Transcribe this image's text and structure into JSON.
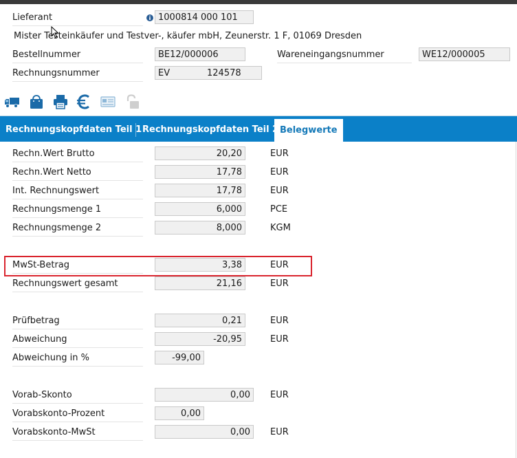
{
  "header": {
    "lieferant_label": "Lieferant",
    "lieferant_value": "1000814 000 101",
    "address": "Mister Testeinkäufer und Testver-, käufer mbH, Zeunerstr. 1 F, 01069 Dresden",
    "bestellnummer_label": "Bestellnummer",
    "bestellnummer_value": "BE12/000006",
    "wareneingang_label": "Wareneingangsnummer",
    "wareneingang_value": "WE12/000005",
    "rechnungsnummer_label": "Rechnungsnummer",
    "rechnungsnummer_prefix": "EV",
    "rechnungsnummer_value": "124578"
  },
  "toolbar": {
    "icons": [
      "truck-icon",
      "bag-icon",
      "printer-icon",
      "euro-icon",
      "card-icon",
      "lock-icon"
    ],
    "colors": {
      "primary": "#1479b8"
    }
  },
  "tabs": [
    {
      "label": "Rechnungskopfdaten Teil 1",
      "active": false
    },
    {
      "label": "Rechnungskopfdaten Teil 2",
      "active": false
    },
    {
      "label": "Belegwerte",
      "active": true
    }
  ],
  "rows": {
    "brutto": {
      "label": "Rechn.Wert Brutto",
      "value": "20,20",
      "unit": "EUR"
    },
    "netto": {
      "label": "Rechn.Wert Netto",
      "value": "17,78",
      "unit": "EUR"
    },
    "int_wert": {
      "label": "Int. Rechnungswert",
      "value": "17,78",
      "unit": "EUR"
    },
    "menge1": {
      "label": "Rechnungsmenge 1",
      "value": "6,000",
      "unit": "PCE"
    },
    "menge2": {
      "label": "Rechnungsmenge 2",
      "value": "8,000",
      "unit": "KGM"
    },
    "mwst": {
      "label": "MwSt-Betrag",
      "value": "3,38",
      "unit": "EUR"
    },
    "gesamt": {
      "label": "Rechnungswert gesamt",
      "value": "21,16",
      "unit": "EUR"
    },
    "pruef": {
      "label": "Prüfbetrag",
      "value": "0,21",
      "unit": "EUR"
    },
    "abw": {
      "label": "Abweichung",
      "value": "-20,95",
      "unit": "EUR"
    },
    "abw_pct": {
      "label": "Abweichung in %",
      "value": "-99,00"
    },
    "skonto": {
      "label": "Vorab-Skonto",
      "value": "0,00",
      "unit": "EUR"
    },
    "skonto_pct": {
      "label": "Vorabskonto-Prozent",
      "value": "0,00"
    },
    "skonto_mwst": {
      "label": "Vorabskonto-MwSt",
      "value": "0,00",
      "unit": "EUR"
    }
  },
  "highlight_color": "#d9232d"
}
